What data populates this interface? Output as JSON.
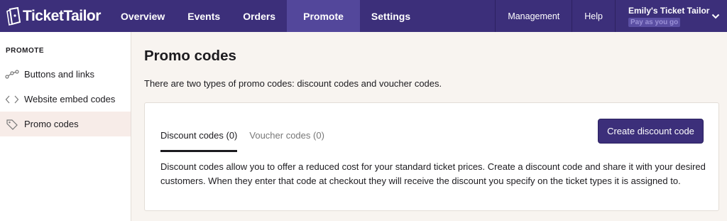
{
  "brand": {
    "name": "TicketTailor"
  },
  "topnav": {
    "items": [
      {
        "label": "Overview"
      },
      {
        "label": "Events"
      },
      {
        "label": "Orders"
      },
      {
        "label": "Promote"
      },
      {
        "label": "Settings"
      }
    ],
    "active": "Promote",
    "management": "Management",
    "help": "Help",
    "account_name": "Emily's Ticket Tailor",
    "plan": "Pay as you go"
  },
  "sidebar": {
    "heading": "PROMOTE",
    "items": [
      {
        "label": "Buttons and links",
        "icon": "share-nodes-icon"
      },
      {
        "label": "Website embed codes",
        "icon": "code-brackets-icon"
      },
      {
        "label": "Promo codes",
        "icon": "tag-icon"
      }
    ],
    "active": "Promo codes"
  },
  "main": {
    "title": "Promo codes",
    "intro": "There are two types of promo codes: discount codes and voucher codes.",
    "tabs": [
      {
        "label": "Discount codes (0)"
      },
      {
        "label": "Voucher codes (0)"
      }
    ],
    "create_button": "Create discount code",
    "description": "Discount codes allow you to offer a reduced cost for your standard ticket prices. Create a discount code and share it with your desired customers. When they enter that code at checkout they will receive the discount you specify on the ticket types it is assigned to."
  },
  "colors": {
    "brand": "#3c2f7a",
    "active_nav": "#53479b",
    "active_side": "#f7ece8",
    "background": "#f8f4f0"
  }
}
